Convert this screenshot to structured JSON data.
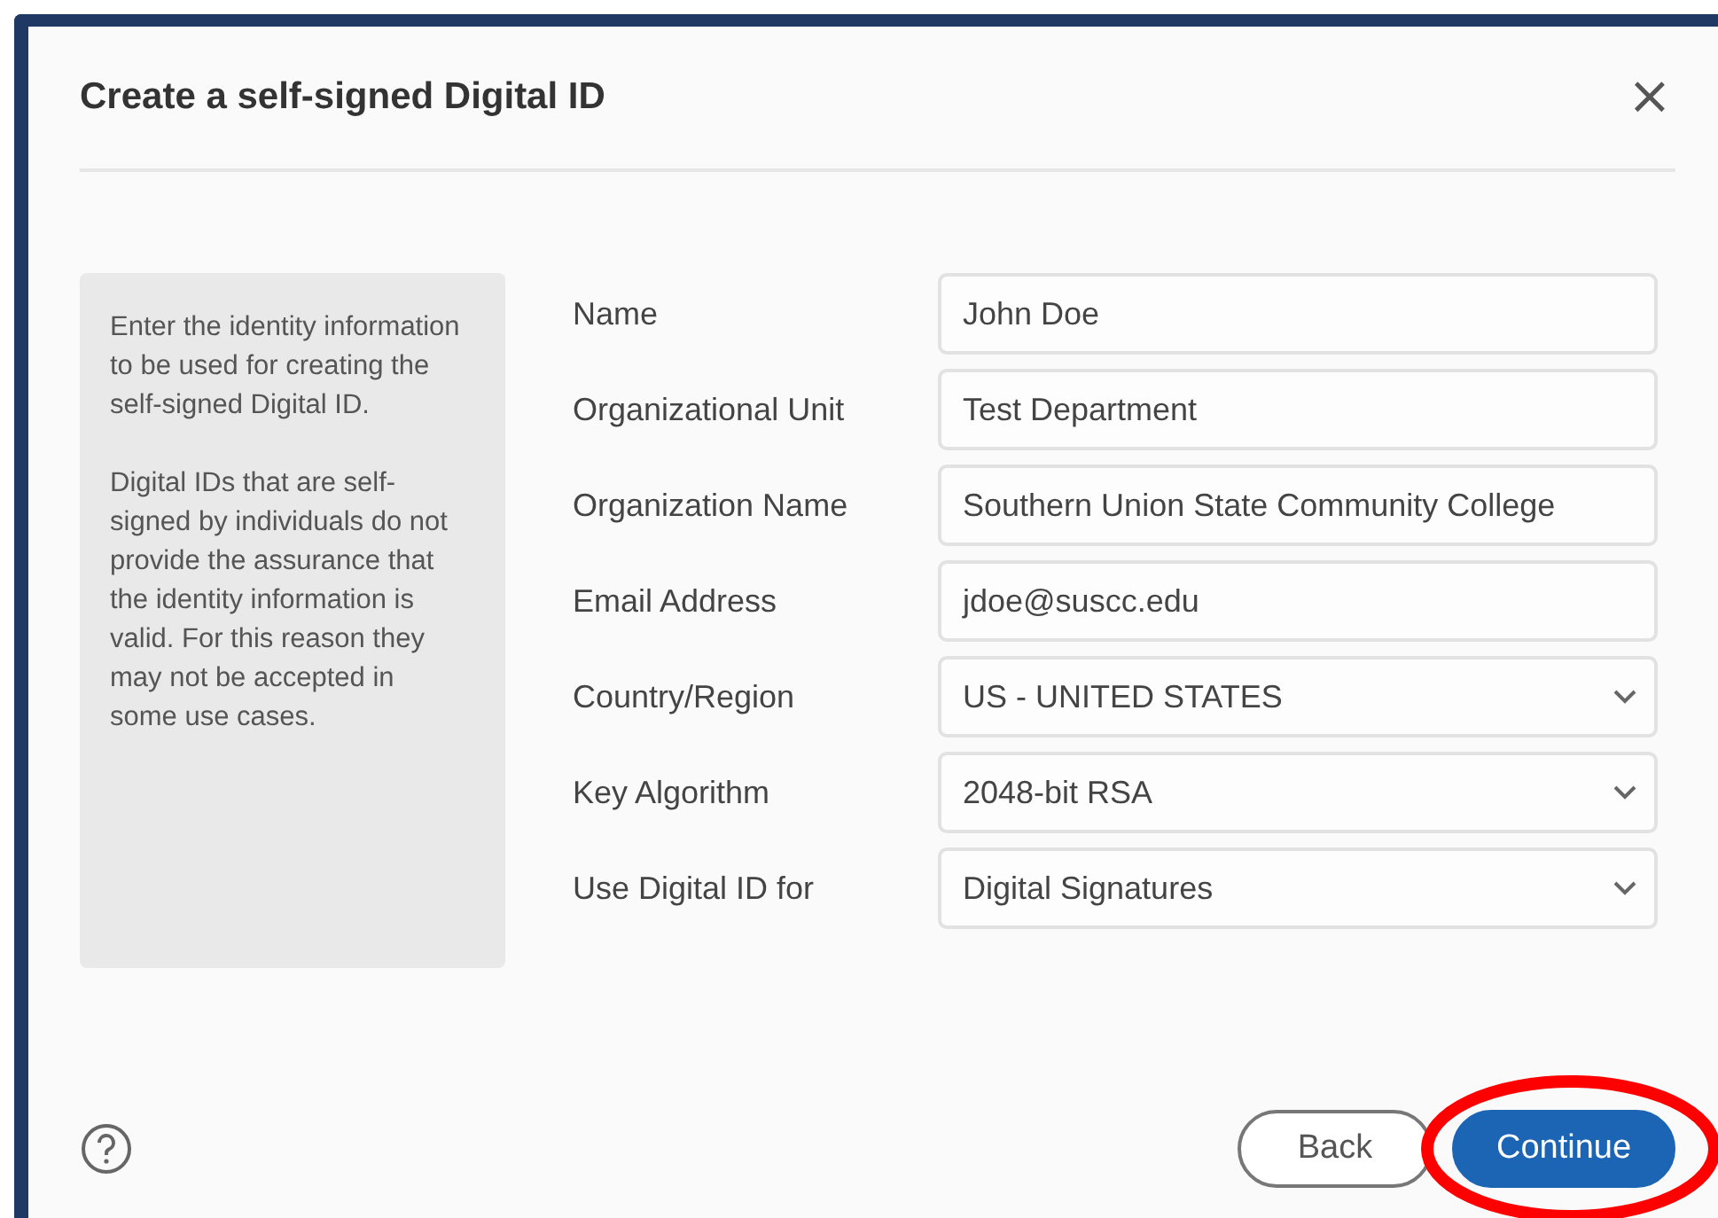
{
  "dialog": {
    "title": "Create a self-signed Digital ID",
    "close": "×"
  },
  "info": [
    "Enter the identity information to be used for creating the self-signed Digital ID.",
    "Digital IDs that are self-signed by individuals do not provide the assurance that the identity information is valid. For this reason they may not be accepted in some use cases."
  ],
  "fields": [
    {
      "label": "Name",
      "kind": "text",
      "value": "John Doe"
    },
    {
      "label": "Organizational Unit",
      "kind": "text",
      "value": "Test Department"
    },
    {
      "label": "Organization Name",
      "kind": "text",
      "value": "Southern Union State Community College"
    },
    {
      "label": "Email Address",
      "kind": "text",
      "value": "jdoe@suscc.edu"
    },
    {
      "label": "Country/Region",
      "kind": "select",
      "value": "US - UNITED STATES"
    },
    {
      "label": "Key Algorithm",
      "kind": "select",
      "value": "2048-bit RSA"
    },
    {
      "label": "Use Digital ID for",
      "kind": "select",
      "value": "Digital Signatures"
    }
  ],
  "buttons": [
    {
      "label": "Back",
      "kind": "secondary",
      "highlighted": false
    },
    {
      "label": "Continue",
      "kind": "primary",
      "highlighted": true
    }
  ]
}
